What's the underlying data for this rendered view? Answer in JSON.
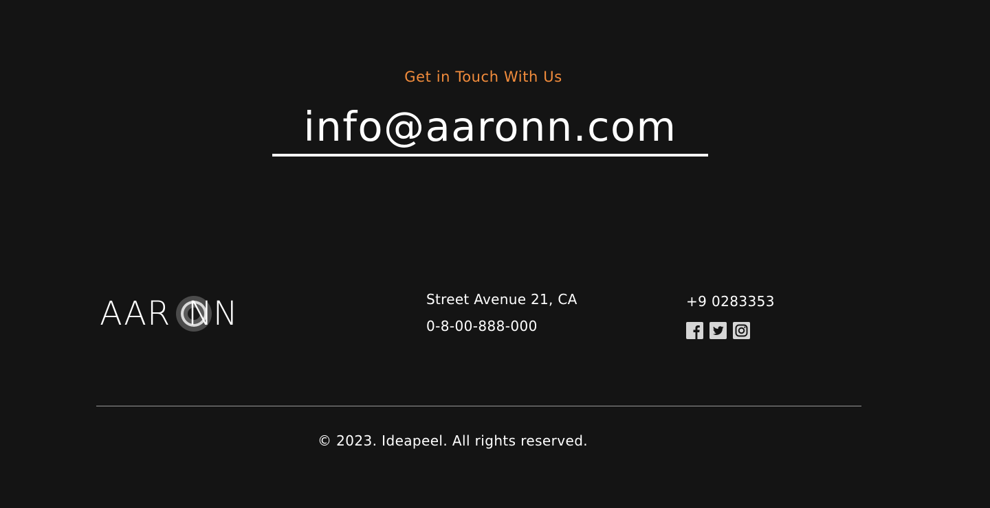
{
  "contact": {
    "kicker": "Get in Touch With Us",
    "email": "info@aaronn.com"
  },
  "brand": {
    "logo_left": "AAR",
    "logo_right": "NN",
    "accent_color": "#f28c3c"
  },
  "footer": {
    "address": "Street Avenue 21, CA",
    "alt_phone": "0-8-00-888-000",
    "phone": "+9 0283353",
    "social": [
      {
        "name": "facebook",
        "icon": "facebook-icon"
      },
      {
        "name": "twitter",
        "icon": "twitter-icon"
      },
      {
        "name": "instagram",
        "icon": "instagram-icon"
      }
    ],
    "copyright": "© 2023. Ideapeel. All rights reserved."
  }
}
